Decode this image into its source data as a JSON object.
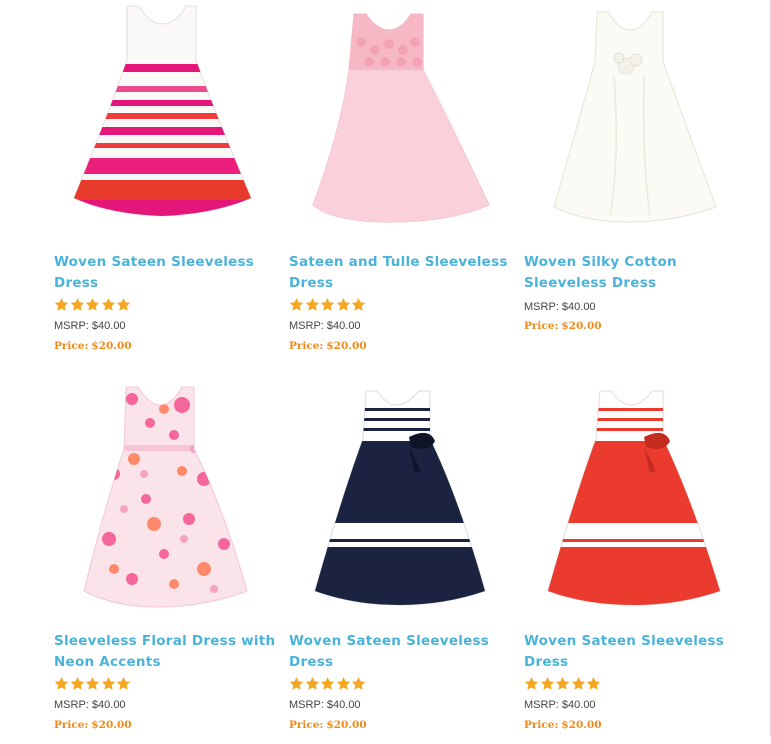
{
  "products": [
    {
      "title": "Woven Sateen Sleeveless Dress",
      "rating": 5,
      "msrp_label": "MSRP:",
      "msrp": "$40.00",
      "price_label": "Price:",
      "price": "$20.00"
    },
    {
      "title": "Sateen and Tulle Sleeveless Dress",
      "rating": 5,
      "msrp_label": "MSRP:",
      "msrp": "$40.00",
      "price_label": "Price:",
      "price": "$20.00"
    },
    {
      "title": "Woven Silky Cotton Sleeveless Dress",
      "msrp_label": "MSRP:",
      "msrp": "$40.00",
      "price_label": "Price:",
      "price": "$20.00"
    },
    {
      "title": "Sleeveless Floral Dress with Neon Accents",
      "rating": 5,
      "msrp_label": "MSRP:",
      "msrp": "$40.00",
      "price_label": "Price:",
      "price": "$20.00"
    },
    {
      "title": "Woven Sateen Sleeveless Dress",
      "rating": 5,
      "msrp_label": "MSRP:",
      "msrp": "$40.00",
      "price_label": "Price:",
      "price": "$20.00"
    },
    {
      "title": "Woven Sateen Sleeveless Dress",
      "rating": 5,
      "msrp_label": "MSRP:",
      "msrp": "$40.00",
      "price_label": "Price:",
      "price": "$20.00"
    }
  ],
  "colors": {
    "title": "#4ab3d9",
    "price": "#f08a17",
    "star": "#f5a623"
  }
}
